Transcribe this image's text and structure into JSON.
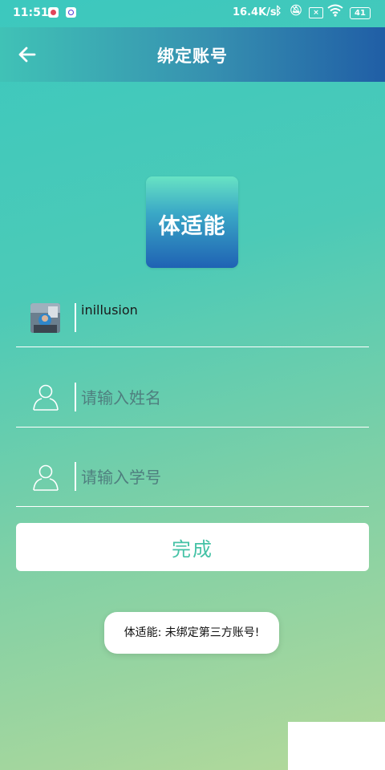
{
  "status_bar": {
    "time": "11:51",
    "net_speed": "16.4K/s",
    "sim_label": "×",
    "battery": "41"
  },
  "header": {
    "title": "绑定账号"
  },
  "logo": {
    "text": "体适能"
  },
  "account": {
    "username": "inillusion"
  },
  "form": {
    "name_placeholder": "请输入姓名",
    "student_id_placeholder": "请输入学号",
    "submit_label": "完成"
  },
  "toast": {
    "message": "体适能: 未绑定第三方账号!"
  },
  "colors": {
    "accent": "#45c2a6",
    "header_end": "#205ea6"
  }
}
